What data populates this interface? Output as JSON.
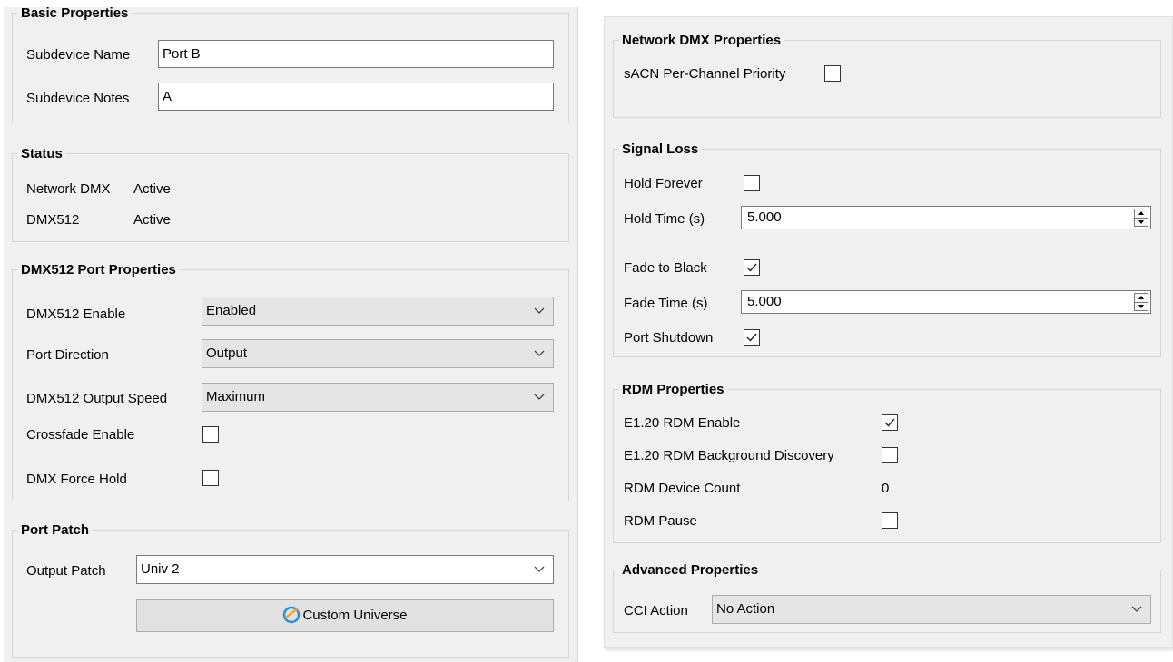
{
  "left": {
    "basic": {
      "title": "Basic Properties",
      "subdevice_name_label": "Subdevice Name",
      "subdevice_name_value": "Port B",
      "subdevice_notes_label": "Subdevice Notes",
      "subdevice_notes_value": "A"
    },
    "status": {
      "title": "Status",
      "network_dmx_label": "Network DMX",
      "network_dmx_value": "Active",
      "dmx512_label": "DMX512",
      "dmx512_value": "Active"
    },
    "dmx_port": {
      "title": "DMX512 Port Properties",
      "enable_label": "DMX512 Enable",
      "enable_value": "Enabled",
      "direction_label": "Port Direction",
      "direction_value": "Output",
      "speed_label": "DMX512 Output Speed",
      "speed_value": "Maximum",
      "crossfade_label": "Crossfade Enable",
      "crossfade_checked": false,
      "force_hold_label": "DMX Force Hold",
      "force_hold_checked": false
    },
    "patch": {
      "title": "Port Patch",
      "output_label": "Output Patch",
      "output_value": "Univ 2",
      "custom_universe_label": "Custom Universe"
    }
  },
  "right": {
    "network": {
      "title": "Network DMX Properties",
      "sacn_label": "sACN Per-Channel Priority",
      "sacn_checked": false
    },
    "signal_loss": {
      "title": "Signal Loss",
      "hold_forever_label": "Hold Forever",
      "hold_forever_checked": false,
      "hold_time_label": "Hold Time (s)",
      "hold_time_value": "5.000",
      "fade_black_label": "Fade to Black",
      "fade_black_checked": true,
      "fade_time_label": "Fade Time (s)",
      "fade_time_value": "5.000",
      "shutdown_label": "Port Shutdown",
      "shutdown_checked": true
    },
    "rdm": {
      "title": "RDM Properties",
      "enable_label": "E1.20 RDM Enable",
      "enable_checked": true,
      "bg_discovery_label": "E1.20 RDM Background Discovery",
      "bg_discovery_checked": false,
      "device_count_label": "RDM Device Count",
      "device_count_value": "0",
      "pause_label": "RDM Pause",
      "pause_checked": false
    },
    "advanced": {
      "title": "Advanced Properties",
      "cci_label": "CCI Action",
      "cci_value": "No Action"
    }
  },
  "icons": {
    "chevron": "chevron-down-icon",
    "checkmark": "checkmark-icon",
    "custom_universe": "universe-icon"
  },
  "colors": {
    "panel_bg": "#f0f0f0",
    "group_border": "#d6d6d6",
    "combo_bg": "#e5e5e5",
    "icon_blue": "#2a8fd8",
    "icon_orange": "#f5a623"
  }
}
